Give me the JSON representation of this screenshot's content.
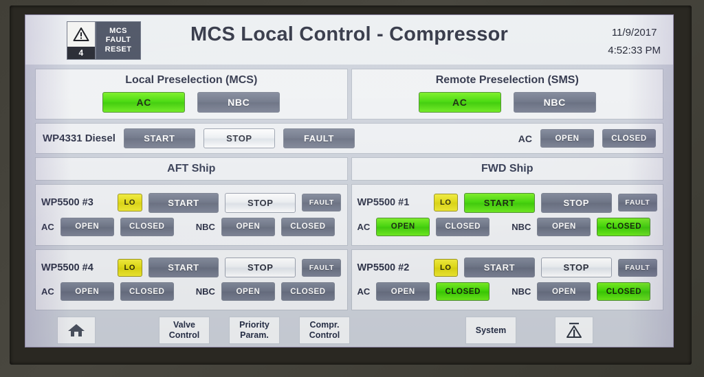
{
  "header": {
    "alarm_icon": "warning-triangle-icon",
    "alarm_count": "4",
    "fault_reset_label": "MCS\nFAULT\nRESET",
    "fault_reset_line1": "MCS",
    "fault_reset_line2": "FAULT",
    "fault_reset_line3": "RESET",
    "title": "MCS Local Control - Compressor",
    "date": "11/9/2017",
    "time": "4:52:33 PM"
  },
  "preselection": [
    {
      "title": "Local Preselection (MCS)",
      "buttons": [
        {
          "label": "AC",
          "state": "active"
        },
        {
          "label": "NBC",
          "state": "inactive"
        }
      ]
    },
    {
      "title": "Remote Preselection (SMS)",
      "buttons": [
        {
          "label": "AC",
          "state": "active"
        },
        {
          "label": "NBC",
          "state": "inactive"
        }
      ]
    }
  ],
  "diesel": {
    "name": "WP4331 Diesel",
    "start": {
      "label": "START",
      "state": "inactive"
    },
    "stop": {
      "label": "STOP",
      "state": "light"
    },
    "fault": {
      "label": "FAULT",
      "state": "inactive"
    },
    "valve_label": "AC",
    "open": {
      "label": "OPEN",
      "state": "inactive"
    },
    "closed": {
      "label": "CLOSED",
      "state": "inactive"
    }
  },
  "ships": [
    {
      "heading": "AFT Ship",
      "units": [
        {
          "name": "WP5500 #3",
          "lo": {
            "label": "LO",
            "state": "warning"
          },
          "start": {
            "label": "START",
            "state": "inactive"
          },
          "stop": {
            "label": "STOP",
            "state": "light"
          },
          "fault": {
            "label": "FAULT",
            "state": "inactive"
          },
          "valves": [
            {
              "label": "AC",
              "open": {
                "label": "OPEN",
                "state": "inactive"
              },
              "closed": {
                "label": "CLOSED",
                "state": "inactive"
              }
            },
            {
              "label": "NBC",
              "open": {
                "label": "OPEN",
                "state": "inactive"
              },
              "closed": {
                "label": "CLOSED",
                "state": "inactive"
              }
            }
          ]
        },
        {
          "name": "WP5500 #4",
          "lo": {
            "label": "LO",
            "state": "warning"
          },
          "start": {
            "label": "START",
            "state": "inactive"
          },
          "stop": {
            "label": "STOP",
            "state": "light"
          },
          "fault": {
            "label": "FAULT",
            "state": "inactive"
          },
          "valves": [
            {
              "label": "AC",
              "open": {
                "label": "OPEN",
                "state": "inactive"
              },
              "closed": {
                "label": "CLOSED",
                "state": "inactive"
              }
            },
            {
              "label": "NBC",
              "open": {
                "label": "OPEN",
                "state": "inactive"
              },
              "closed": {
                "label": "CLOSED",
                "state": "inactive"
              }
            }
          ]
        }
      ]
    },
    {
      "heading": "FWD Ship",
      "units": [
        {
          "name": "WP5500 #1",
          "lo": {
            "label": "LO",
            "state": "warning"
          },
          "start": {
            "label": "START",
            "state": "active"
          },
          "stop": {
            "label": "STOP",
            "state": "inactive"
          },
          "fault": {
            "label": "FAULT",
            "state": "inactive"
          },
          "valves": [
            {
              "label": "AC",
              "open": {
                "label": "OPEN",
                "state": "active"
              },
              "closed": {
                "label": "CLOSED",
                "state": "inactive"
              }
            },
            {
              "label": "NBC",
              "open": {
                "label": "OPEN",
                "state": "inactive"
              },
              "closed": {
                "label": "CLOSED",
                "state": "active"
              }
            }
          ]
        },
        {
          "name": "WP5500 #2",
          "lo": {
            "label": "LO",
            "state": "warning"
          },
          "start": {
            "label": "START",
            "state": "inactive"
          },
          "stop": {
            "label": "STOP",
            "state": "light"
          },
          "fault": {
            "label": "FAULT",
            "state": "inactive"
          },
          "valves": [
            {
              "label": "AC",
              "open": {
                "label": "OPEN",
                "state": "inactive"
              },
              "closed": {
                "label": "CLOSED",
                "state": "active"
              }
            },
            {
              "label": "NBC",
              "open": {
                "label": "OPEN",
                "state": "inactive"
              },
              "closed": {
                "label": "CLOSED",
                "state": "active"
              }
            }
          ]
        }
      ]
    }
  ],
  "footer": {
    "home": {
      "icon": "home-icon"
    },
    "valve_control": "Valve\nControl",
    "valve_control_l1": "Valve",
    "valve_control_l2": "Control",
    "priority_param_l1": "Priority",
    "priority_param_l2": "Param.",
    "compr_control_l1": "Compr.",
    "compr_control_l2": "Control",
    "system": "System",
    "alarm": {
      "icon": "alarm-triangle-icon"
    }
  },
  "colors": {
    "active_green": "#42d807",
    "warning_yellow": "#e3dc12",
    "inactive_blue": "#5c6478",
    "screen_bg": "#cdd2db",
    "panel_bg": "#eff1f4",
    "text_dark": "#2c3147"
  }
}
